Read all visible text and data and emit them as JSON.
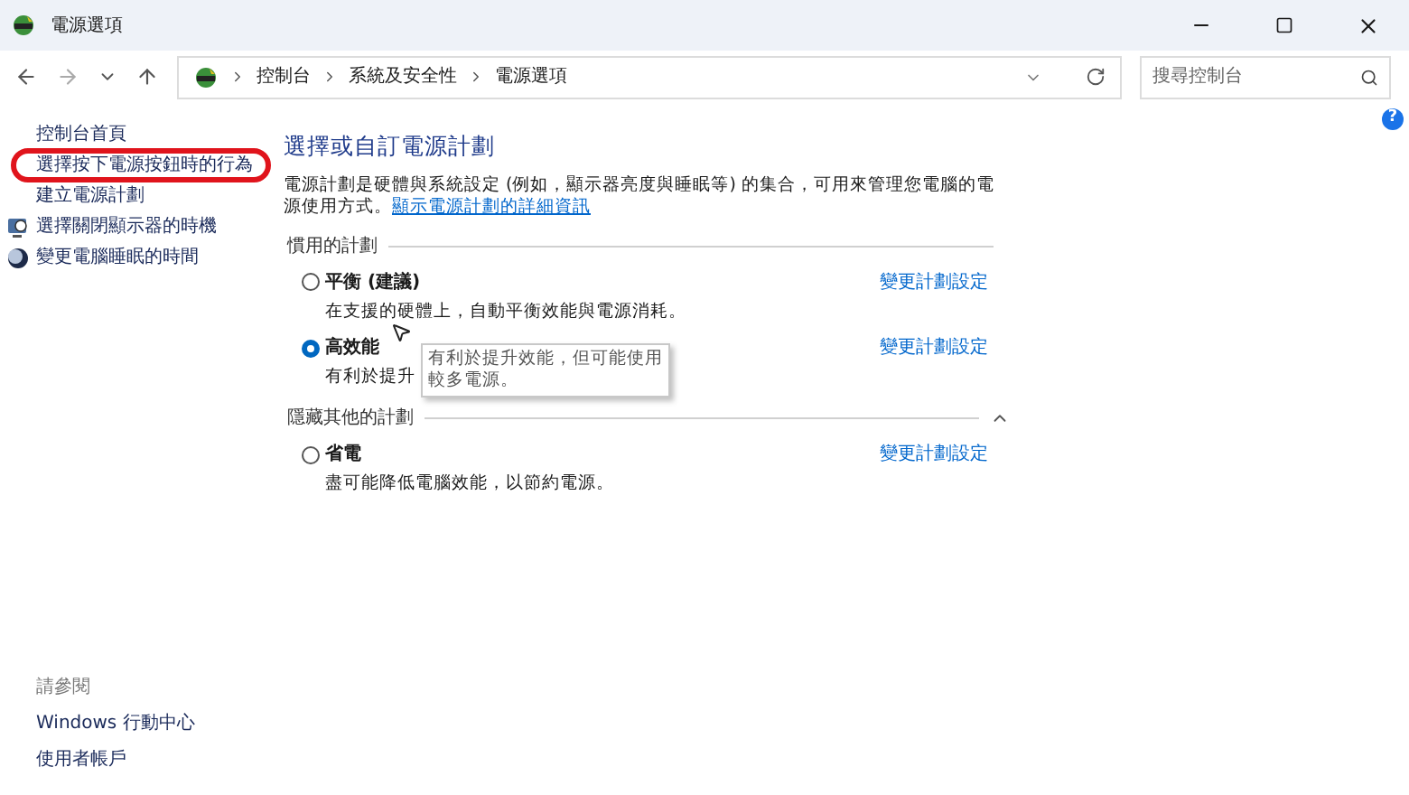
{
  "window": {
    "title": "電源選項"
  },
  "navigation": {
    "breadcrumb": [
      "控制台",
      "系統及安全性",
      "電源選項"
    ],
    "search": {
      "placeholder": "搜尋控制台"
    }
  },
  "sidebar": {
    "items": [
      {
        "label": "控制台首頁",
        "kind": "text",
        "highlighted": false
      },
      {
        "label": "選擇按下電源按鈕時的行為",
        "kind": "text",
        "highlighted": true
      },
      {
        "label": "建立電源計劃",
        "kind": "text",
        "highlighted": false
      },
      {
        "label": "選擇關閉顯示器的時機",
        "kind": "monitor",
        "highlighted": false
      },
      {
        "label": "變更電腦睡眠的時間",
        "kind": "sleep",
        "highlighted": false
      }
    ],
    "see_also": {
      "heading": "請參閱",
      "links": [
        "Windows 行動中心",
        "使用者帳戶"
      ]
    }
  },
  "main": {
    "title": "選擇或自訂電源計劃",
    "description": "電源計劃是硬體與系統設定 (例如，顯示器亮度與睡眠等) 的集合，可用來管理您電腦的電源使用方式。",
    "link": "顯示電源計劃的詳細資訊",
    "groups": [
      {
        "heading": "慣用的計劃",
        "collapsible": false,
        "plans": [
          {
            "name": "平衡 (建議)",
            "selected": false,
            "description": "在支援的硬體上，自動平衡效能與電源消耗。",
            "action": "變更計劃設定"
          },
          {
            "name": "高效能",
            "selected": true,
            "description": "有利於提升",
            "action": "變更計劃設定"
          }
        ]
      },
      {
        "heading": "隱藏其他的計劃",
        "collapsible": true,
        "plans": [
          {
            "name": "省電",
            "selected": false,
            "description": "盡可能降低電腦效能，以節約電源。",
            "action": "變更計劃設定"
          }
        ]
      }
    ]
  },
  "help": {
    "label": "?"
  },
  "tooltip": {
    "text": "有利於提升效能，但可能使用較多電源。"
  }
}
